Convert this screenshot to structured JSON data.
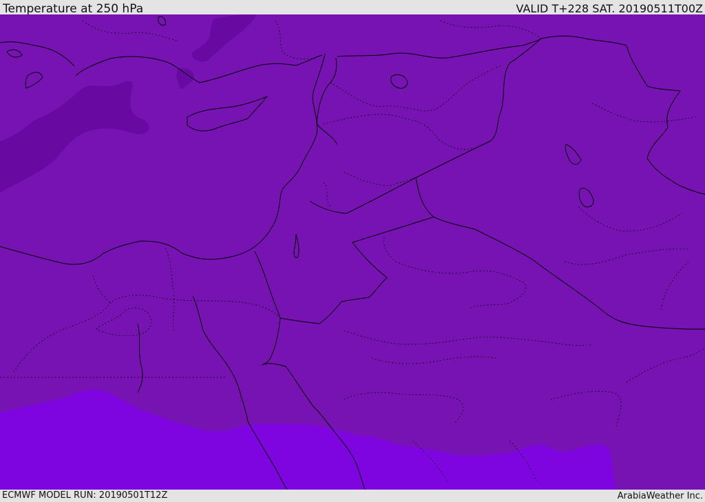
{
  "header": {
    "title": "Temperature at 250 hPa",
    "valid": "VALID T+228 SAT. 20190511T00Z"
  },
  "footer": {
    "model_run": "ECMWF MODEL RUN: 20190501T12Z",
    "credit": "ArabiaWeather Inc."
  },
  "map": {
    "colors": {
      "base": "#7713b2",
      "cold_band": "#680aa2",
      "warm_band": "#7e05df",
      "border": "#000000"
    }
  }
}
